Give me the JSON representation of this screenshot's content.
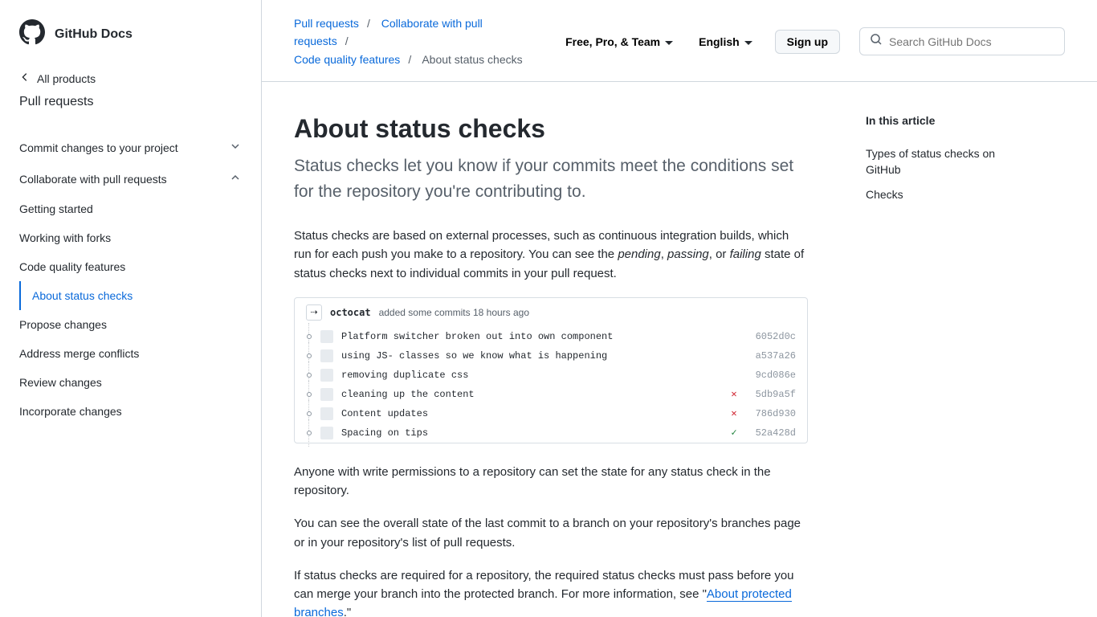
{
  "site_title": "GitHub Docs",
  "all_products": "All products",
  "section": "Pull requests",
  "sidebar": {
    "items": [
      {
        "label": "Commit changes to your project",
        "expanded": false,
        "children": []
      },
      {
        "label": "Collaborate with pull requests",
        "expanded": true,
        "children": [
          {
            "label": "Getting started"
          },
          {
            "label": "Working with forks"
          },
          {
            "label": "Code quality features",
            "children": [
              {
                "label": "About status checks",
                "active": true
              }
            ]
          },
          {
            "label": "Propose changes"
          },
          {
            "label": "Address merge conflicts"
          },
          {
            "label": "Review changes"
          },
          {
            "label": "Incorporate changes"
          }
        ]
      }
    ]
  },
  "breadcrumbs": [
    {
      "label": "Pull requests",
      "link": true
    },
    {
      "label": "Collaborate with pull requests",
      "link": true
    },
    {
      "label": "Code quality features",
      "link": true
    },
    {
      "label": "About status checks",
      "link": false
    }
  ],
  "plan_label": "Free, Pro, & Team",
  "language_label": "English",
  "signup_label": "Sign up",
  "search_placeholder": "Search GitHub Docs",
  "article": {
    "title": "About status checks",
    "subtitle": "Status checks let you know if your commits meet the conditions set for the repository you're contributing to.",
    "para1_a": "Status checks are based on external processes, such as continuous integration builds, which run for each push you make to a repository. You can see the ",
    "pending": "pending",
    "comma1": ", ",
    "passing": "passing",
    "comma2": ", or ",
    "failing": "failing",
    "para1_b": " state of status checks next to individual commits in your pull request.",
    "commit_author": "octocat",
    "commit_meta": "added some commits 18 hours ago",
    "commits": [
      {
        "msg": "Platform switcher broken out into own component",
        "status": "none",
        "sha": "6052d0c"
      },
      {
        "msg": "using JS- classes so we know what is happening",
        "status": "none",
        "sha": "a537a26"
      },
      {
        "msg": "removing duplicate css",
        "status": "none",
        "sha": "9cd086e"
      },
      {
        "msg": "cleaning up the content",
        "status": "fail",
        "sha": "5db9a5f"
      },
      {
        "msg": "Content updates",
        "status": "fail",
        "sha": "786d930"
      },
      {
        "msg": "Spacing on tips",
        "status": "pass",
        "sha": "52a428d"
      }
    ],
    "para2": "Anyone with write permissions to a repository can set the state for any status check in the repository.",
    "para3": "You can see the overall state of the last commit to a branch on your repository's branches page or in your repository's list of pull requests.",
    "para4_a": "If status checks are required for a repository, the required status checks must pass before you can merge your branch into the protected branch. For more information, see \"",
    "para4_link": "About protected branches",
    "para4_b": ".\""
  },
  "toc": {
    "title": "In this article",
    "items": [
      "Types of status checks on GitHub",
      "Checks"
    ]
  }
}
